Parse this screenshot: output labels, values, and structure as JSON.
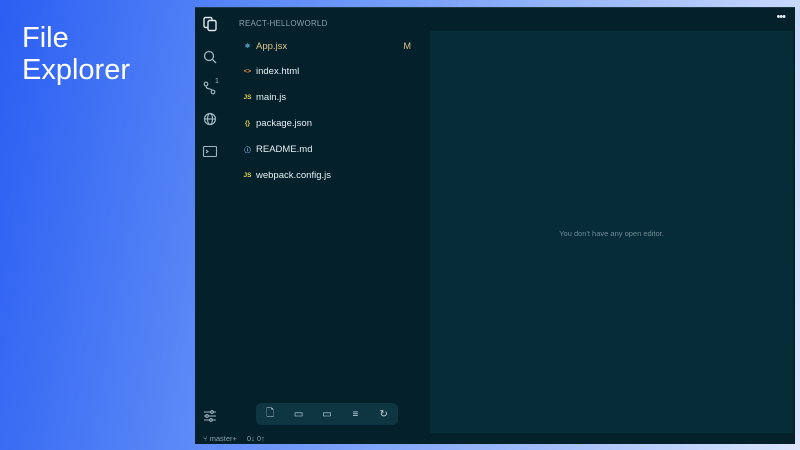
{
  "slide_title": "File Explorer",
  "project_name": "REACT-HELLOWORLD",
  "scm_count": "1",
  "files": [
    {
      "name": "App.jsx",
      "icon": "react-icon",
      "glyph": "⚛",
      "color": "#5fb6e0",
      "badge": "M",
      "modified": true
    },
    {
      "name": "index.html",
      "icon": "html-icon",
      "glyph": "<>",
      "color": "#e08a4a"
    },
    {
      "name": "main.js",
      "icon": "js-icon",
      "glyph": "JS",
      "color": "#e8d44d"
    },
    {
      "name": "package.json",
      "icon": "json-icon",
      "glyph": "{}",
      "color": "#e8d44d"
    },
    {
      "name": "README.md",
      "icon": "info-icon",
      "glyph": "ⓘ",
      "color": "#6fa8dc"
    },
    {
      "name": "webpack.config.js",
      "icon": "js-icon",
      "glyph": "JS",
      "color": "#e8d44d"
    }
  ],
  "editor": {
    "empty_message": "You don't have any open editor.",
    "more": "•••"
  },
  "status": {
    "branch": "master+",
    "sync": "0↓ 0↑"
  }
}
